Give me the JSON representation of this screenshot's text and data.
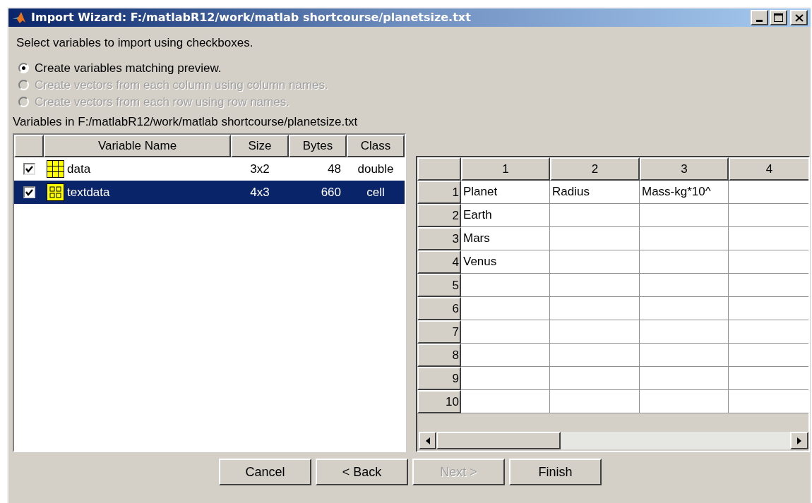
{
  "window": {
    "title": "Import Wizard: F:/matlabR12/work/matlab shortcourse/planetsize.txt"
  },
  "instruction": "Select variables to import using checkboxes.",
  "options": [
    {
      "label": "Create variables matching preview.",
      "selected": true,
      "disabled": false
    },
    {
      "label": "Create vectors from each column using column names.",
      "selected": false,
      "disabled": true
    },
    {
      "label": "Create vectors from each row using row names.",
      "selected": false,
      "disabled": true
    }
  ],
  "variables_label": "Variables in F:/matlabR12/work/matlab shortcourse/planetsize.txt",
  "variables": {
    "columns": [
      "Variable Name",
      "Size",
      "Bytes",
      "Class"
    ],
    "rows": [
      {
        "kind": "matrix",
        "name": "data",
        "size": "3x2",
        "bytes": "48",
        "class": "double",
        "checked": true,
        "selected": false
      },
      {
        "kind": "cell",
        "name": "textdata",
        "size": "4x3",
        "bytes": "660",
        "class": "cell",
        "checked": true,
        "selected": true
      }
    ]
  },
  "preview": {
    "columns": [
      "1",
      "2",
      "3",
      "4"
    ],
    "rows": [
      {
        "header": "1",
        "cells": [
          "Planet",
          "Radius",
          "Mass-kg*10^"
        ]
      },
      {
        "header": "2",
        "cells": [
          "Earth"
        ]
      },
      {
        "header": "3",
        "cells": [
          "Mars"
        ]
      },
      {
        "header": "4",
        "cells": [
          "Venus"
        ]
      },
      {
        "header": "5"
      },
      {
        "header": "6"
      },
      {
        "header": "7"
      },
      {
        "header": "8"
      },
      {
        "header": "9"
      },
      {
        "header": "10"
      }
    ]
  },
  "buttons": [
    {
      "label": "Cancel",
      "disabled": false
    },
    {
      "label": "< Back",
      "disabled": false
    },
    {
      "label": "Next >",
      "disabled": true
    },
    {
      "label": "Finish",
      "disabled": false
    }
  ]
}
